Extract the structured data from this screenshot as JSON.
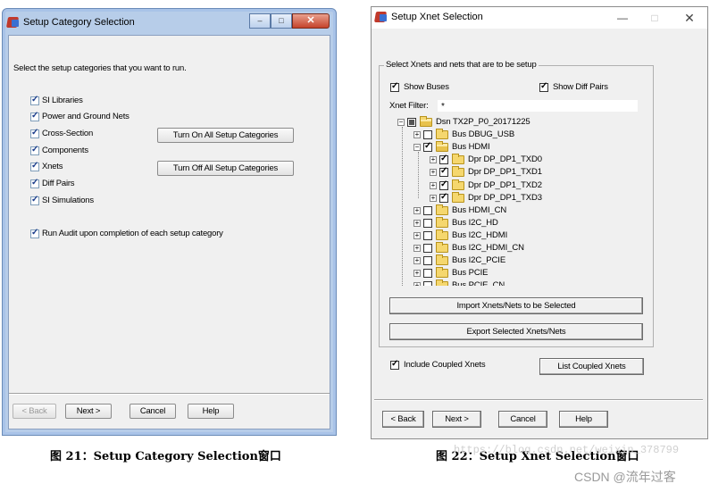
{
  "left_window": {
    "title": "Setup Category Selection",
    "instruction": "Select the setup categories that you want to run.",
    "categories": [
      {
        "label": "SI Libraries",
        "checked": true
      },
      {
        "label": "Power and Ground Nets",
        "checked": true
      },
      {
        "label": "Cross-Section",
        "checked": true
      },
      {
        "label": "Components",
        "checked": true
      },
      {
        "label": "Xnets",
        "checked": true
      },
      {
        "label": "Diff Pairs",
        "checked": true
      },
      {
        "label": "SI Simulations",
        "checked": true
      }
    ],
    "turn_on_all": "Turn On All Setup Categories",
    "turn_off_all": "Turn Off All Setup Categories",
    "run_audit": {
      "label": "Run Audit upon completion of each setup category",
      "checked": true
    },
    "back": "< Back",
    "next": "Next >",
    "cancel": "Cancel",
    "help": "Help",
    "caption_buttons": {
      "minimize": "–",
      "maximize": "□",
      "close": "✕"
    }
  },
  "right_window": {
    "title": "Setup Xnet Selection",
    "caption_buttons": {
      "minimize": "—",
      "maximize": "□",
      "close": "✕"
    },
    "group_label": "Select Xnets and nets that are to be setup",
    "show_buses": {
      "label": "Show Buses",
      "checked": true
    },
    "show_diff_pairs": {
      "label": "Show Diff Pairs",
      "checked": true
    },
    "filter_label": "Xnet Filter:",
    "filter_value": "*",
    "tree": [
      {
        "level": 0,
        "label": "Dsn TX2P_P0_20171225",
        "state": "partial",
        "open": true,
        "expander": "−"
      },
      {
        "level": 1,
        "label": "Bus DBUG_USB",
        "state": "off",
        "open": false,
        "expander": "+"
      },
      {
        "level": 1,
        "label": "Bus HDMI",
        "state": "on",
        "open": true,
        "expander": "−"
      },
      {
        "level": 2,
        "label": "Dpr DP_DP1_TXD0",
        "state": "on",
        "open": false,
        "expander": "+"
      },
      {
        "level": 2,
        "label": "Dpr DP_DP1_TXD1",
        "state": "on",
        "open": false,
        "expander": "+"
      },
      {
        "level": 2,
        "label": "Dpr DP_DP1_TXD2",
        "state": "on",
        "open": false,
        "expander": "+"
      },
      {
        "level": 2,
        "label": "Dpr DP_DP1_TXD3",
        "state": "on",
        "open": false,
        "expander": "+"
      },
      {
        "level": 1,
        "label": "Bus HDMI_CN",
        "state": "off",
        "open": false,
        "expander": "+"
      },
      {
        "level": 1,
        "label": "Bus I2C_HD",
        "state": "off",
        "open": false,
        "expander": "+"
      },
      {
        "level": 1,
        "label": "Bus I2C_HDMI",
        "state": "off",
        "open": false,
        "expander": "+"
      },
      {
        "level": 1,
        "label": "Bus I2C_HDMI_CN",
        "state": "off",
        "open": false,
        "expander": "+"
      },
      {
        "level": 1,
        "label": "Bus I2C_PCIE",
        "state": "off",
        "open": false,
        "expander": "+"
      },
      {
        "level": 1,
        "label": "Bus PCIE",
        "state": "off",
        "open": false,
        "expander": "+"
      },
      {
        "level": 1,
        "label": "Bus PCIE_CN",
        "state": "off",
        "open": false,
        "expander": "+"
      }
    ],
    "import_btn": "Import Xnets/Nets to be Selected",
    "export_btn": "Export Selected Xnets/Nets",
    "include_coupled": {
      "label": "Include Coupled Xnets",
      "checked": true
    },
    "list_coupled": "List Coupled Xnets",
    "back": "< Back",
    "next": "Next >",
    "cancel": "Cancel",
    "help": "Help"
  },
  "captions": {
    "left": "图 21：Setup Category Selection窗口",
    "right": "图 22：Setup Xnet Selection窗口"
  },
  "watermark": "https://blog.csdn.net/weixin_378799",
  "csdn_credit": "CSDN @流年过客",
  "colors": {
    "window_bg": "#f0f0f0",
    "aero_frame": "#b7cde9",
    "close_red": "#c4432b"
  }
}
